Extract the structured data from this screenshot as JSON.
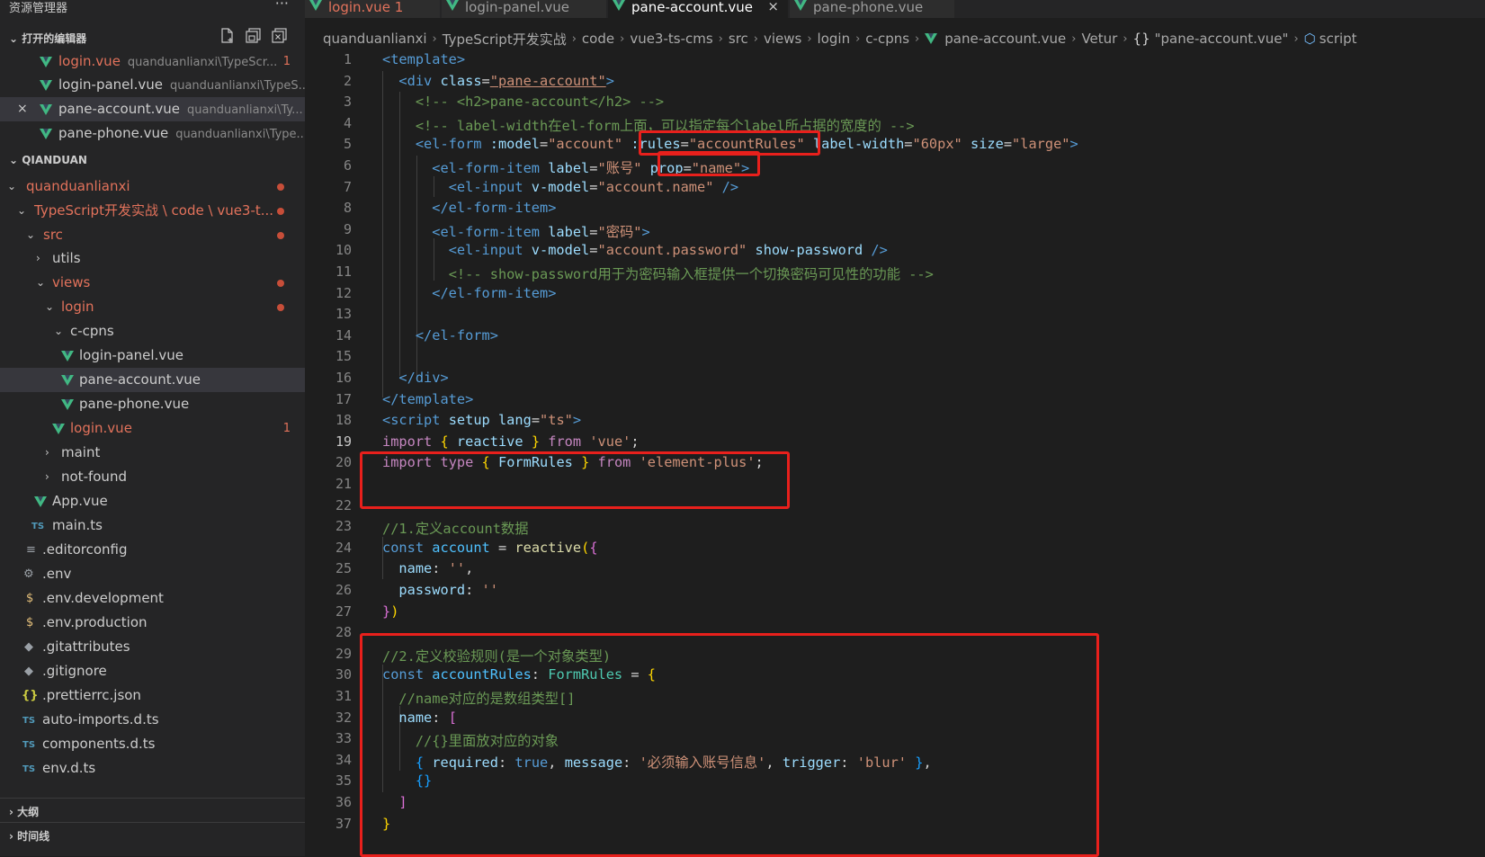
{
  "explorer": {
    "title": "资源管理器",
    "more": "···",
    "open_editors_label": "打开的编辑器",
    "workspace_label": "QIANDUAN",
    "outline_label": "大纲",
    "timeline_label": "时间线"
  },
  "open_editors": [
    {
      "name": "login.vue",
      "path": "quanduanlianxi\\TypeScr...",
      "badge": "1"
    },
    {
      "name": "login-panel.vue",
      "path": "quanduanlianxi\\TypeS..."
    },
    {
      "name": "pane-account.vue",
      "path": "quanduanlianxi\\Ty..."
    },
    {
      "name": "pane-phone.vue",
      "path": "quanduanlianxi\\Type..."
    }
  ],
  "tree": {
    "root": "quanduanlianxi",
    "project": "TypeScript开发实战 \\ code \\ vue3-t...",
    "src": "src",
    "utils": "utils",
    "views": "views",
    "login": "login",
    "ccpns": "c-cpns",
    "login_panel": "login-panel.vue",
    "pane_account": "pane-account.vue",
    "pane_phone": "pane-phone.vue",
    "login_vue": "login.vue",
    "login_vue_badge": "1",
    "maint": "maint",
    "not_found": "not-found",
    "app_vue": "App.vue",
    "main_ts": "main.ts",
    "editorconfig": ".editorconfig",
    "env": ".env",
    "env_dev": ".env.development",
    "env_prod": ".env.production",
    "gitattributes": ".gitattributes",
    "gitignore": ".gitignore",
    "prettierrc": ".prettierrc.json",
    "auto_imports": "auto-imports.d.ts",
    "components": "components.d.ts",
    "env_dts": "env.d.ts"
  },
  "tabs": [
    {
      "name": "login.vue",
      "badge": "1"
    },
    {
      "name": "login-panel.vue"
    },
    {
      "name": "pane-account.vue"
    },
    {
      "name": "pane-phone.vue"
    }
  ],
  "breadcrumb": [
    "quanduanlianxi",
    "TypeScript开发实战",
    "code",
    "vue3-ts-cms",
    "src",
    "views",
    "login",
    "c-cpns",
    "pane-account.vue",
    "Vetur",
    "\"pane-account.vue\"",
    "script"
  ],
  "icons": {
    "vue": "vue-logo-icon",
    "ts": "TS",
    "close": "×",
    "chev_down": "⌄",
    "chev_right": "›"
  },
  "code": {
    "l1": "<template>",
    "l2a": "<div ",
    "l2b": "class",
    "l2c": "=",
    "l2d": "\"pane-account\"",
    "l2e": ">",
    "l3": "<!-- <h2>pane-account</h2> -->",
    "l4": "<!-- label-width在el-form上面，可以指定每个label所占据的宽度的 -->",
    "l5a": "<el-form ",
    "l5b": ":model",
    "l5c": "=",
    "l5d": "\"account\"",
    "l5e": ":rules",
    "l5f": "=",
    "l5g": "\"accountRules\"",
    "l5h": "label-width",
    "l5i": "=",
    "l5j": "\"60px\"",
    "l5k": "size",
    "l5l": "=",
    "l5m": "\"large\"",
    "l5n": ">",
    "l6a": "<el-form-item ",
    "l6b": "label",
    "l6c": "=",
    "l6d": "\"账号\"",
    "l6e": "prop",
    "l6f": "=",
    "l6g": "\"name\"",
    "l6h": ">",
    "l7a": "<el-input ",
    "l7b": "v-model",
    "l7c": "=",
    "l7d": "\"account.name\"",
    "l7e": " />",
    "l8": "</el-form-item>",
    "l9a": "<el-form-item ",
    "l9b": "label",
    "l9c": "=",
    "l9d": "\"密码\"",
    "l9e": ">",
    "l10a": "<el-input ",
    "l10b": "v-model",
    "l10c": "=",
    "l10d": "\"account.password\"",
    "l10e": "show-password",
    "l10f": " />",
    "l11": "<!-- show-password用于为密码输入框提供一个切换密码可见性的功能 -->",
    "l12": "</el-form-item>",
    "l14": "</el-form>",
    "l16": "</div>",
    "l17": "</template>",
    "l18a": "<script ",
    "l18b": "setup",
    "l18c": "lang",
    "l18d": "=",
    "l18e": "\"ts\"",
    "l18f": ">",
    "l19a": "import",
    "l19b": "{",
    "l19c": "reactive",
    "l19d": "}",
    "l19e": "from",
    "l19f": "'vue'",
    "l19g": ";",
    "l20a": "import",
    "l20b": "type",
    "l20c": "{",
    "l20d": "FormRules",
    "l20e": "}",
    "l20f": "from",
    "l20g": "'element-plus'",
    "l20h": ";",
    "l23": "//1.定义account数据",
    "l24a": "const",
    "l24b": "account",
    "l24c": "=",
    "l24d": "reactive",
    "l24e": "(",
    "l24f": "{",
    "l25a": "name",
    "l25b": ":",
    "l25c": "''",
    "l25d": ",",
    "l26a": "password",
    "l26b": ":",
    "l26c": "''",
    "l27a": "}",
    "l27b": ")",
    "l29": "//2.定义校验规则(是一个对象类型)",
    "l30a": "const",
    "l30b": "accountRules",
    "l30c": ":",
    "l30d": "FormRules",
    "l30e": "=",
    "l30f": "{",
    "l31": "//name对应的是数组类型[]",
    "l32a": "name",
    "l32b": ":",
    "l32c": "[",
    "l33": "//{}里面放对应的对象",
    "l34a": "{",
    "l34b": "required",
    "l34c": ":",
    "l34d": "true",
    "l34e": ",",
    "l34f": "message",
    "l34g": ":",
    "l34h": "'必须输入账号信息'",
    "l34i": ",",
    "l34j": "trigger",
    "l34k": ":",
    "l34l": "'blur'",
    "l34m": "}",
    "l34n": ",",
    "l35": "{}",
    "l36": "]",
    "l37": "}"
  },
  "line_numbers": [
    "1",
    "2",
    "3",
    "4",
    "5",
    "6",
    "7",
    "8",
    "9",
    "10",
    "11",
    "12",
    "13",
    "14",
    "15",
    "16",
    "17",
    "18",
    "19",
    "20",
    "21",
    "22",
    "23",
    "24",
    "25",
    "26",
    "27",
    "28",
    "29",
    "30",
    "31",
    "32",
    "33",
    "34",
    "35",
    "36",
    "37"
  ],
  "colors": {
    "highlight_box": "#e8201c",
    "vue_green": "#41b883",
    "modified": "#e2725b"
  }
}
